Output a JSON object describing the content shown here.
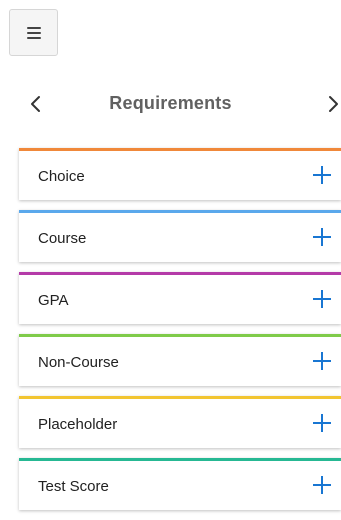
{
  "header": {
    "title": "Requirements",
    "prev_icon": "chevron-left-icon",
    "next_icon": "chevron-right-icon"
  },
  "menu": {
    "icon": "hamburger-menu-icon"
  },
  "requirements": [
    {
      "label": "Choice",
      "color": "#f0883a"
    },
    {
      "label": "Course",
      "color": "#5aa8ec"
    },
    {
      "label": "GPA",
      "color": "#b43ba8"
    },
    {
      "label": "Non-Course",
      "color": "#7fcb4a"
    },
    {
      "label": "Placeholder",
      "color": "#f2c531"
    },
    {
      "label": "Test Score",
      "color": "#26b893"
    }
  ],
  "add_icon": "plus-icon",
  "colors": {
    "accent": "#1976d2",
    "title": "#616161"
  }
}
